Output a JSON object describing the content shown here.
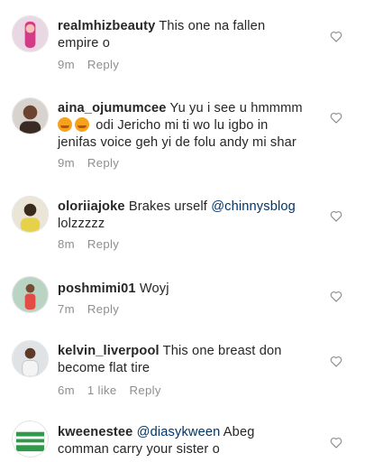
{
  "comments": [
    {
      "username": "realmhizbeauty",
      "line1": "This one na fallen",
      "line2": "empire o",
      "time": "9m",
      "reply": "Reply"
    },
    {
      "username": "aina_ojumumcee",
      "line1": "Yu yu i see u hmmmm",
      "line2": "odi Jericho mi ti wo lu igbo in",
      "line3": "jenifas voice geh yi de folu andy mi shar",
      "time": "9m",
      "reply": "Reply",
      "emojis": [
        "face-emoji",
        "face-emoji"
      ]
    },
    {
      "username": "oloriiajoke",
      "line1_text": "Brakes urself",
      "mention": "@chinnysblog",
      "line2": "lolzzzzz",
      "time": "8m",
      "reply": "Reply"
    },
    {
      "username": "poshmimi01",
      "line1": "Woyj",
      "time": "7m",
      "reply": "Reply"
    },
    {
      "username": "kelvin_liverpool",
      "line1": "This one breast don",
      "line2": "become flat tire",
      "time": "6m",
      "likes": "1 like",
      "reply": "Reply"
    },
    {
      "username": "kweenestee",
      "mention": "@diasykween",
      "line1_text": "Abeg",
      "line2": "comman carry your sister o"
    }
  ],
  "icons": {
    "like": "heart-outline-icon"
  },
  "colors": {
    "text": "#262626",
    "meta": "#8e8e8e",
    "mention": "#003569"
  }
}
